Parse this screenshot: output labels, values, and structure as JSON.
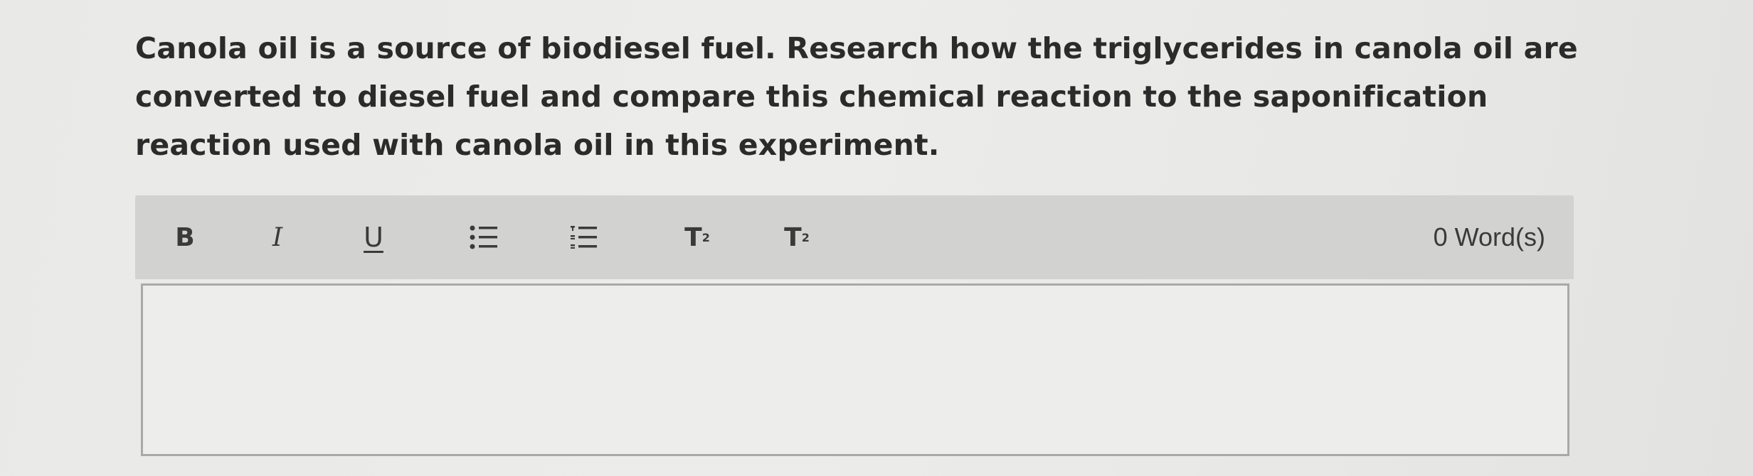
{
  "question": {
    "text": "Canola oil is a source of biodiesel fuel. Research how the triglycerides in canola oil are converted to diesel fuel and compare this chemical reaction to the saponification reaction used with canola oil in this experiment."
  },
  "toolbar": {
    "bold_label": "B",
    "italic_label": "I",
    "underline_label": "U",
    "bullet_list_icon": "bulleted-list-icon",
    "numbered_list_icon": "numbered-list-icon",
    "superscript_label": "T",
    "superscript_mark": "2",
    "subscript_label": "T",
    "subscript_mark": "2",
    "word_count": "0 Word(s)"
  },
  "editor": {
    "value": ""
  }
}
